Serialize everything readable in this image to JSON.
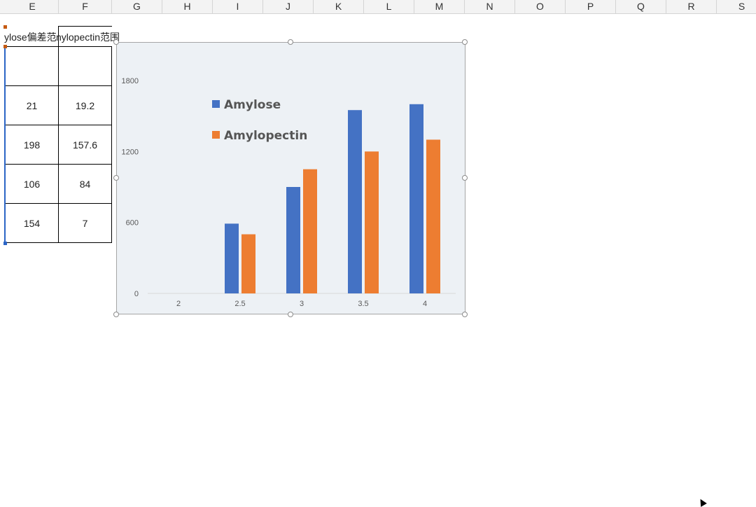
{
  "columns": [
    "E",
    "F",
    "G",
    "H",
    "I",
    "J",
    "K",
    "L",
    "M",
    "N",
    "O",
    "P",
    "Q",
    "R",
    "S"
  ],
  "table": {
    "header_e": "ylose偏差范",
    "header_f": "nylopectin范围",
    "rows": [
      {
        "e": "",
        "f": ""
      },
      {
        "e": "21",
        "f": "19.2"
      },
      {
        "e": "198",
        "f": "157.6"
      },
      {
        "e": "106",
        "f": "84"
      },
      {
        "e": "154",
        "f": "7"
      }
    ]
  },
  "colors": {
    "amylose": "#4472c4",
    "amylopectin": "#ed7d31",
    "selection": "#2b65c6"
  },
  "chart_data": {
    "type": "bar",
    "categories": [
      "2",
      "2.5",
      "3",
      "3.5",
      "4"
    ],
    "series": [
      {
        "name": "Amylose",
        "values": [
          0,
          590,
          900,
          1550,
          1600
        ]
      },
      {
        "name": "Amylopectin",
        "values": [
          0,
          500,
          1050,
          1200,
          1300
        ]
      }
    ],
    "yticks": [
      "0",
      "600",
      "1200",
      "1800"
    ],
    "ylim": [
      0,
      1800
    ],
    "legend_position": "top-left inside",
    "grid": false
  }
}
